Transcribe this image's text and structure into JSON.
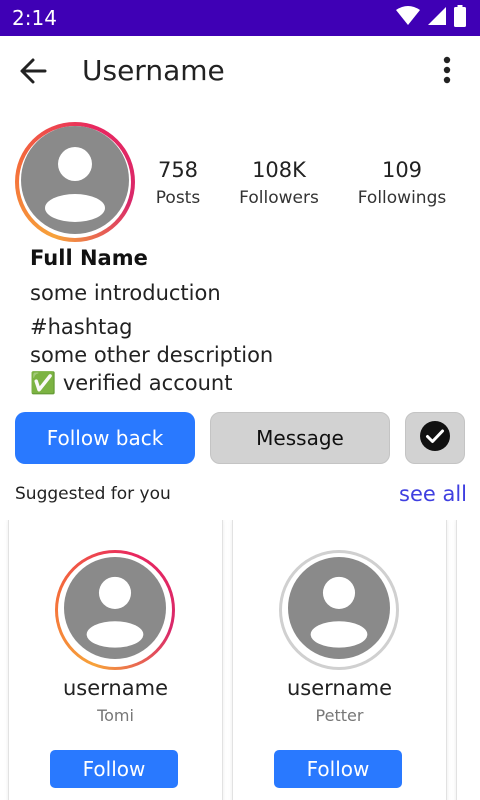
{
  "status_bar": {
    "time": "2:14",
    "icons": [
      "wifi-icon",
      "signal-icon",
      "battery-icon"
    ]
  },
  "app_bar": {
    "title": "Username",
    "back_icon": "arrow-back-icon",
    "menu_icon": "more-vert-icon"
  },
  "profile": {
    "avatar_icon": "person-avatar-icon",
    "stats": [
      {
        "value": "758",
        "label": "Posts"
      },
      {
        "value": "108K",
        "label": "Followers"
      },
      {
        "value": "109",
        "label": "Followings"
      }
    ],
    "full_name": "Full Name",
    "bio_intro": "some introduction",
    "bio_hashtag": "#hashtag",
    "bio_description": "some other description",
    "bio_verified": "✅ verified account"
  },
  "actions": {
    "follow_back": "Follow back",
    "message": "Message",
    "check_icon": "check-circle-icon"
  },
  "suggested": {
    "title": "Suggested for you",
    "see_all": "see all",
    "cards": [
      {
        "username": "username",
        "name": "Tomi",
        "button": "Follow",
        "ring": "gradient"
      },
      {
        "username": "username",
        "name": "Petter",
        "button": "Follow",
        "ring": "gray"
      }
    ]
  },
  "colors": {
    "status_bar": "#3f00b5",
    "primary_button": "#2979ff",
    "secondary_button": "#d2d2d2",
    "link": "#3f3fe0"
  }
}
